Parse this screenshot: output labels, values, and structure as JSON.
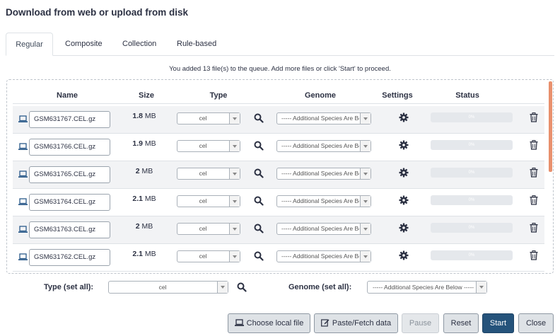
{
  "dialog": {
    "title": "Download from web or upload from disk"
  },
  "tabs": [
    {
      "label": "Regular",
      "active": true
    },
    {
      "label": "Composite",
      "active": false
    },
    {
      "label": "Collection",
      "active": false
    },
    {
      "label": "Rule-based",
      "active": false
    }
  ],
  "helper_text": "You added 13 file(s) to the queue. Add more files or click 'Start' to proceed.",
  "columns": {
    "name": "Name",
    "size": "Size",
    "type": "Type",
    "genome": "Genome",
    "settings": "Settings",
    "status": "Status"
  },
  "rows": [
    {
      "name": "GSM631767.CEL.gz",
      "size_value": "1.8",
      "size_unit": "MB",
      "type": "cel",
      "genome": "----- Additional Species Are Below -----",
      "progress": "0%"
    },
    {
      "name": "GSM631766.CEL.gz",
      "size_value": "1.9",
      "size_unit": "MB",
      "type": "cel",
      "genome": "----- Additional Species Are Below -----",
      "progress": "0%"
    },
    {
      "name": "GSM631765.CEL.gz",
      "size_value": "2",
      "size_unit": "MB",
      "type": "cel",
      "genome": "----- Additional Species Are Below -----",
      "progress": "0%"
    },
    {
      "name": "GSM631764.CEL.gz",
      "size_value": "2.1",
      "size_unit": "MB",
      "type": "cel",
      "genome": "----- Additional Species Are Below -----",
      "progress": "0%"
    },
    {
      "name": "GSM631763.CEL.gz",
      "size_value": "2",
      "size_unit": "MB",
      "type": "cel",
      "genome": "----- Additional Species Are Below -----",
      "progress": "0%"
    },
    {
      "name": "GSM631762.CEL.gz",
      "size_value": "2.1",
      "size_unit": "MB",
      "type": "cel",
      "genome": "----- Additional Species Are Below -----",
      "progress": "0%"
    }
  ],
  "set_all": {
    "type_label": "Type (set all):",
    "type_value": "cel",
    "genome_label": "Genome (set all):",
    "genome_value": "----- Additional Species Are Below -----"
  },
  "buttons": {
    "choose_local": "Choose local file",
    "paste_fetch": "Paste/Fetch data",
    "pause": "Pause",
    "reset": "Reset",
    "start": "Start",
    "close": "Close"
  },
  "colors": {
    "primary": "#25537b",
    "scroll_thumb": "#e8906d"
  }
}
